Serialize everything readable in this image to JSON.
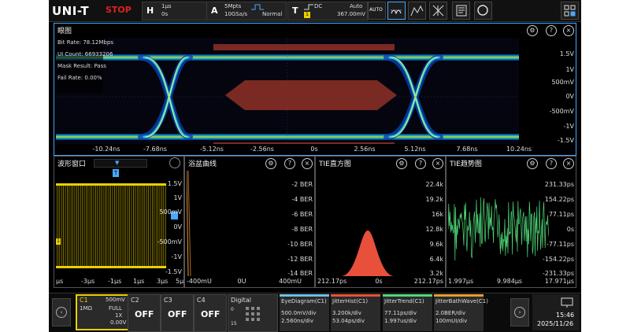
{
  "topbar": {
    "brand": "UNI-T",
    "run_state": "STOP",
    "horizontal": {
      "key": "H",
      "timebase": "1μs",
      "delay": "0s"
    },
    "acquire": {
      "key": "A",
      "memory": "5Mpts",
      "sample_rate": "10GSa/s",
      "mode": "Normal"
    },
    "trigger": {
      "key": "T",
      "coupling": "DC",
      "mode": "Auto",
      "source": "1",
      "level": "367.00mV"
    },
    "auto_label": "AUTO",
    "colors": {
      "run_stop": "#e02020",
      "ch1": "#e8d000"
    }
  },
  "eye": {
    "title": "眼图",
    "stats": {
      "bit_rate": "Bit Rate: 78.12Mbps",
      "ui_count": "UI Count: 66933206",
      "mask_result": "Mask Result: Pass",
      "fail_rate": "Fail Rate: 0.00%"
    },
    "y_labels": [
      "1.5V",
      "1V",
      "500mV",
      "0V",
      "-500mV",
      "-1V",
      "-1.5V"
    ],
    "x_labels": [
      "-10.24ns",
      "-7.68ns",
      "-5.12ns",
      "-2.56ns",
      "0s",
      "2.56ns",
      "5.12ns",
      "7.68ns",
      "10.24ns"
    ]
  },
  "wave": {
    "title": "波形窗口",
    "y_labels": [
      "1.5V",
      "1V",
      "500mV",
      "0V",
      "-500mV",
      "-1V",
      "-1.5V"
    ],
    "x_labels": [
      "μs",
      "-3μs",
      "-1μs",
      "1μs",
      "3μs",
      "5μ"
    ],
    "ch_marker": "1",
    "trig_marker": "T"
  },
  "bathtub": {
    "title": "浴盆曲线",
    "y_labels": [
      "-2 BER",
      "-4 BER",
      "-6 BER",
      "-8 BER",
      "-10 BER",
      "-12 BER",
      "-14 BER"
    ],
    "x_labels": [
      "-400mU",
      "0U",
      "400mU"
    ]
  },
  "hist": {
    "title": "TIE直方图",
    "y_labels": [
      "22.4k",
      "19.2k",
      "16k",
      "12.8k",
      "9.6k",
      "6.4k",
      "3.2k"
    ],
    "x_labels": [
      "212.17ps",
      "0s",
      "212.17ps"
    ]
  },
  "trend": {
    "title": "TIE趋势图",
    "y_labels": [
      "231.33ps",
      "154.22ps",
      "77.11ps",
      "0s",
      "-77.11ps",
      "-154.22ps",
      "-231.33ps"
    ],
    "x_labels": [
      "1.997μs",
      "9.984μs",
      "17.971μs"
    ]
  },
  "channels": {
    "c1": {
      "name": "C1",
      "scale": "500mV",
      "impedance": "1MΩ",
      "bw": "FULL",
      "probe": "1X",
      "offset": "0.00V"
    },
    "c2": {
      "name": "C2",
      "state": "OFF"
    },
    "c3": {
      "name": "C3",
      "state": "OFF"
    },
    "c4": {
      "name": "C4",
      "state": "OFF"
    },
    "digital": {
      "name": "Digital",
      "num_lo": "0",
      "num_hi": "15"
    }
  },
  "math": [
    {
      "title": "EyeDiagram(C1)",
      "line1": "500.0mV/div",
      "line2": "2.560ns/div",
      "color": "#6cc0e8"
    },
    {
      "title": "JitterHist(C1)",
      "line1": "3.200k/div",
      "line2": "53.04ps/div",
      "color": "#e8503c"
    },
    {
      "title": "JitterTrend(C1)",
      "line1": "77.11ps/div",
      "line2": "1.997us/div",
      "color": "#50d878"
    },
    {
      "title": "JitterBathWave(C1)",
      "line1": "2.0BER/div",
      "line2": "100mUI/div",
      "color": "#e89a30"
    }
  ],
  "clock": {
    "time": "15:46",
    "date": "2025/11/26"
  }
}
